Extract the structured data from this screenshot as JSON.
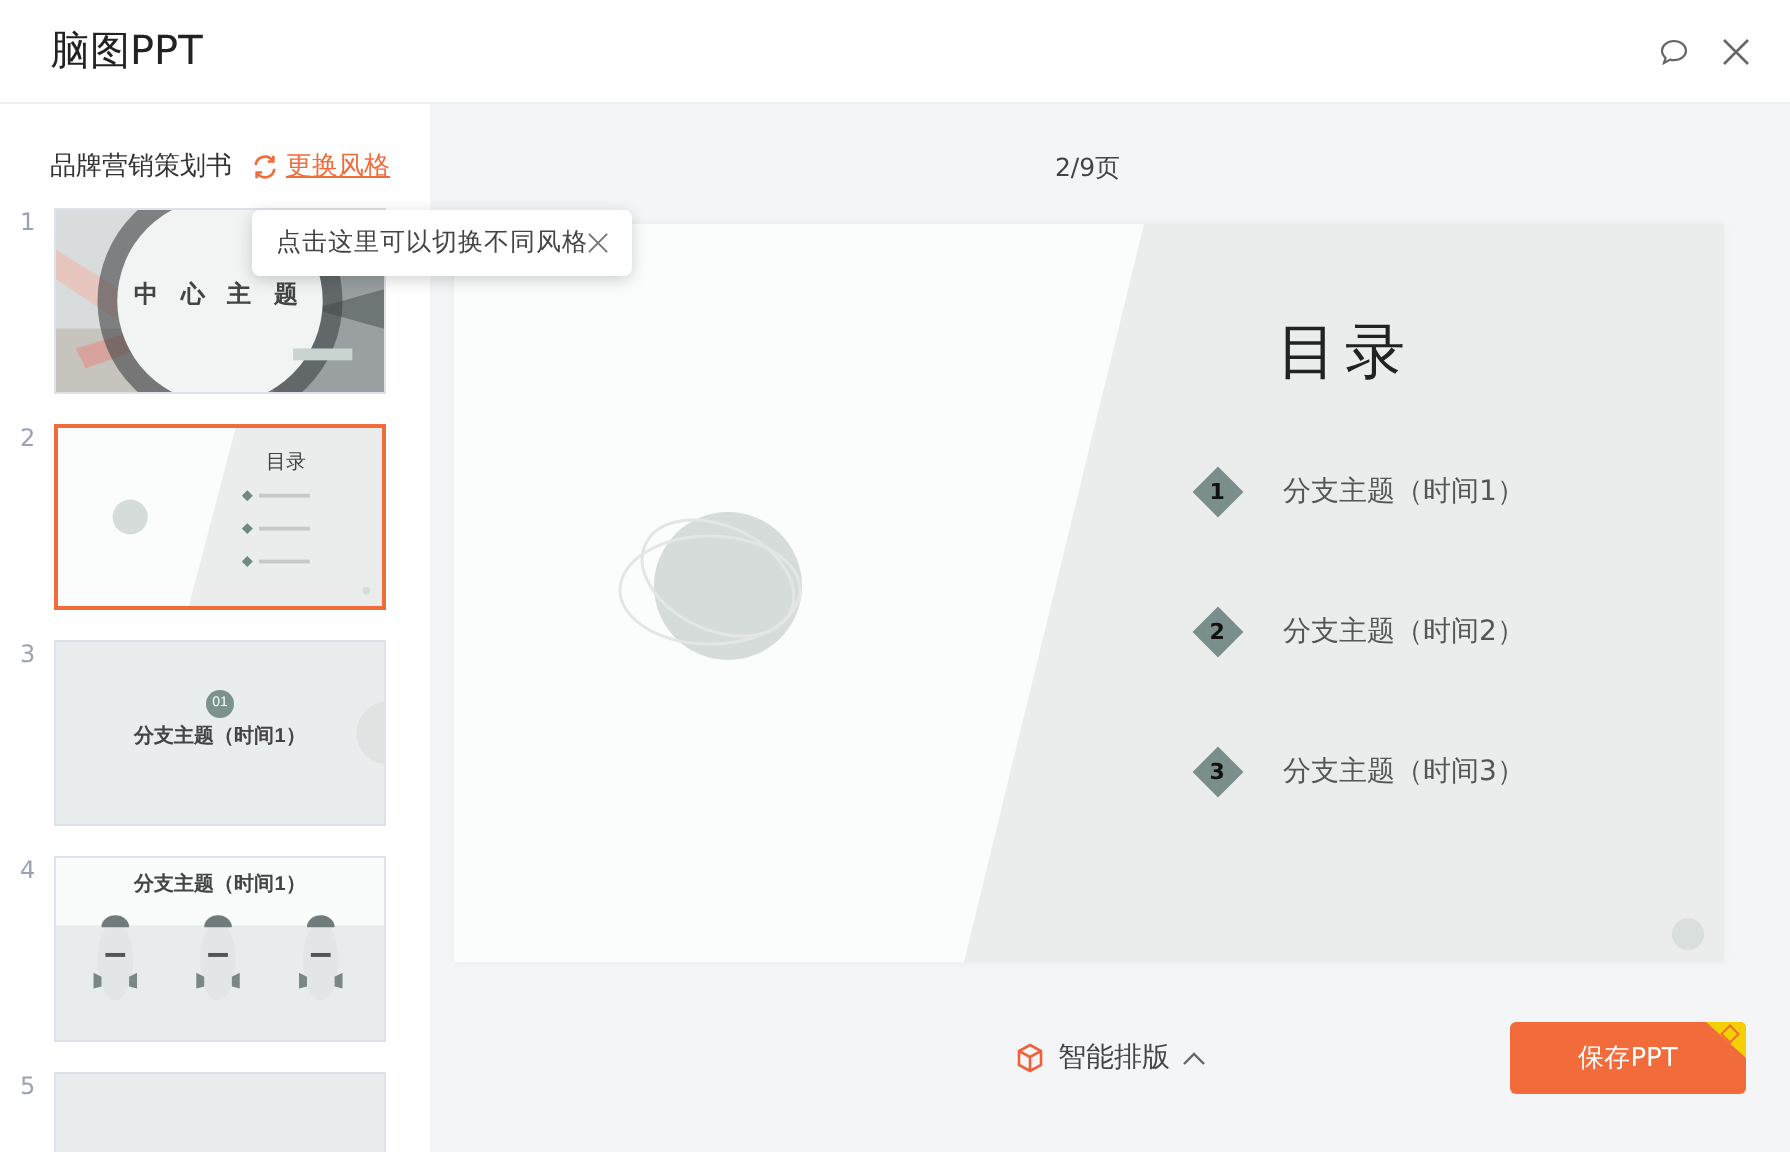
{
  "window": {
    "title": "脑图PPT"
  },
  "sidebar": {
    "document_title": "品牌营销策划书",
    "change_style_link": "更换风格",
    "tooltip": "点击这里可以切换不同风格",
    "slides": [
      {
        "number": "1",
        "kind": "cover",
        "selected": false,
        "title": "中 心 主 题"
      },
      {
        "number": "2",
        "kind": "toc",
        "selected": true,
        "title": "目录"
      },
      {
        "number": "3",
        "kind": "section",
        "selected": false,
        "badge": "01",
        "title": "分支主题（时间1）"
      },
      {
        "number": "4",
        "kind": "rockets",
        "selected": false,
        "title": "分支主题（时间1）"
      },
      {
        "number": "5",
        "kind": "blank",
        "selected": false
      }
    ]
  },
  "page_indicator": "2/9页",
  "slide": {
    "title": "目录",
    "items": [
      {
        "number": "1",
        "text": "分支主题（时间1）"
      },
      {
        "number": "2",
        "text": "分支主题（时间2）"
      },
      {
        "number": "3",
        "text": "分支主题（时间3）"
      }
    ]
  },
  "footer": {
    "layout_button": "智能排版",
    "save_button": "保存PPT"
  }
}
